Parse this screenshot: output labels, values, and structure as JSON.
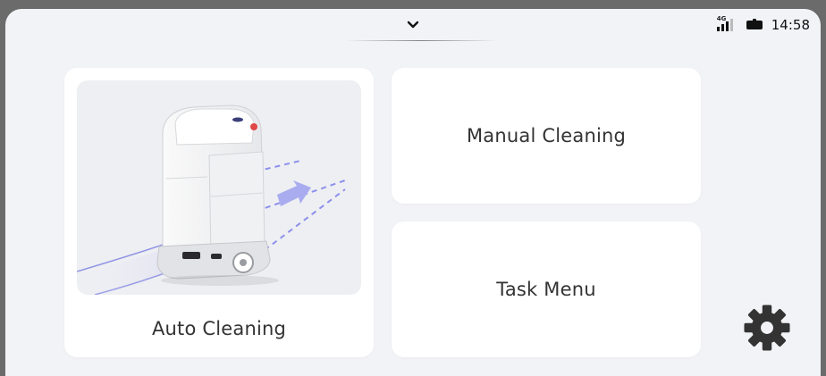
{
  "status_bar": {
    "network_label": "4G",
    "time": "14:58"
  },
  "cards": {
    "auto_cleaning": {
      "label": "Auto Cleaning",
      "image": "robot-cleaner-illustration"
    },
    "manual_cleaning": {
      "label": "Manual Cleaning"
    },
    "task_menu": {
      "label": "Task Menu"
    }
  },
  "icons": {
    "pulldown": "chevron-down-icon",
    "signal": "cellular-signal-icon",
    "battery": "battery-icon",
    "settings": "gear-icon"
  },
  "colors": {
    "screen_bg": "#f2f3f7",
    "card_bg": "#ffffff",
    "text": "#333333",
    "gear": "#333333",
    "path_accent": "#7b7fe0"
  }
}
